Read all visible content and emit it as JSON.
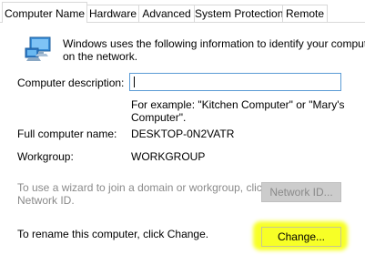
{
  "tabs": [
    {
      "label": "Computer Name",
      "active": true
    },
    {
      "label": "Hardware",
      "active": false
    },
    {
      "label": "Advanced",
      "active": false
    },
    {
      "label": "System Protection",
      "active": false
    },
    {
      "label": "Remote",
      "active": false
    }
  ],
  "intro": {
    "line1": "Windows uses the following information to identify your computer",
    "line2": "on the network.",
    "icon": "computer-monitor-icon"
  },
  "description": {
    "label": "Computer description:",
    "value": "",
    "placeholder": "",
    "hint_line1": "For example: \"Kitchen Computer\" or \"Mary's",
    "hint_line2": "Computer\"."
  },
  "full_name": {
    "label": "Full computer name:",
    "value": "DESKTOP-0N2VATR"
  },
  "workgroup": {
    "label": "Workgroup:",
    "value": "WORKGROUP"
  },
  "network": {
    "text_line1": "To use a wizard to join a domain or workgroup, click",
    "text_line2": "Network ID.",
    "button_label": "Network ID..."
  },
  "rename": {
    "text": "To rename this computer, click Change.",
    "button_label": "Change..."
  },
  "colors": {
    "input_border": "#5b9bd5",
    "highlight": "#f6ff00",
    "disabled_text": "#8a8a8a"
  }
}
